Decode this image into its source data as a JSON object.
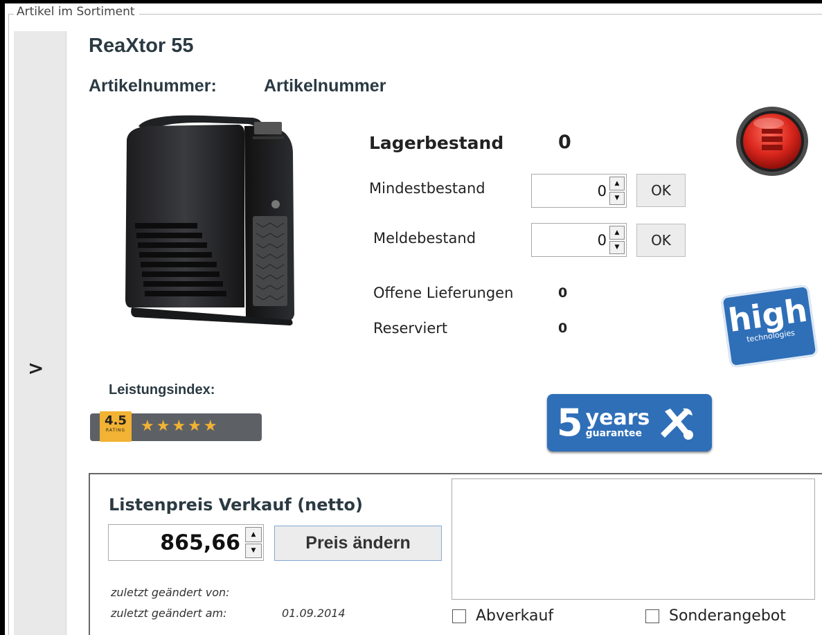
{
  "fieldset": {
    "legend": "Artikel im Sortiment"
  },
  "sidebar": {
    "toggle": ">"
  },
  "article": {
    "name": "ReaXtor 55",
    "number_label": "Artikelnummer:",
    "number_value": "Artikelnummer"
  },
  "stock": {
    "lagerbestand_label": "Lagerbestand",
    "lagerbestand_value": "0",
    "mindestbestand_label": "Mindestbestand",
    "mindestbestand_value": "0",
    "meldebestand_label": "Meldebestand",
    "meldebestand_value": "0",
    "ok_label": "OK",
    "offene_label": "Offene Lieferungen",
    "offene_value": "0",
    "reserviert_label": "Reserviert",
    "reserviert_value": "0",
    "status_color": "#d9261c"
  },
  "performance": {
    "label": "Leistungsindex:",
    "rating": "4.5",
    "rating_caption": "RATING",
    "stars": "★★★★★",
    "rating_value": 4.5,
    "rating_max": 5
  },
  "badges": {
    "high_main": "high",
    "high_sub": "technologies",
    "years_number": "5",
    "years_word": "years",
    "years_sub": "guarantee"
  },
  "price": {
    "heading": "Listenpreis Verkauf (netto)",
    "value": "865,66",
    "change_button": "Preis ändern",
    "changed_by_label": "zuletzt geändert von:",
    "changed_at_label": "zuletzt geändert am:",
    "changed_at_value": "01.09.2014",
    "abverkauf_label": "Abverkauf",
    "sonderangebot_label": "Sonderangebot"
  },
  "colors": {
    "accent": "#2f6fb8",
    "star": "#f2b233",
    "heading": "#2b3a42"
  }
}
